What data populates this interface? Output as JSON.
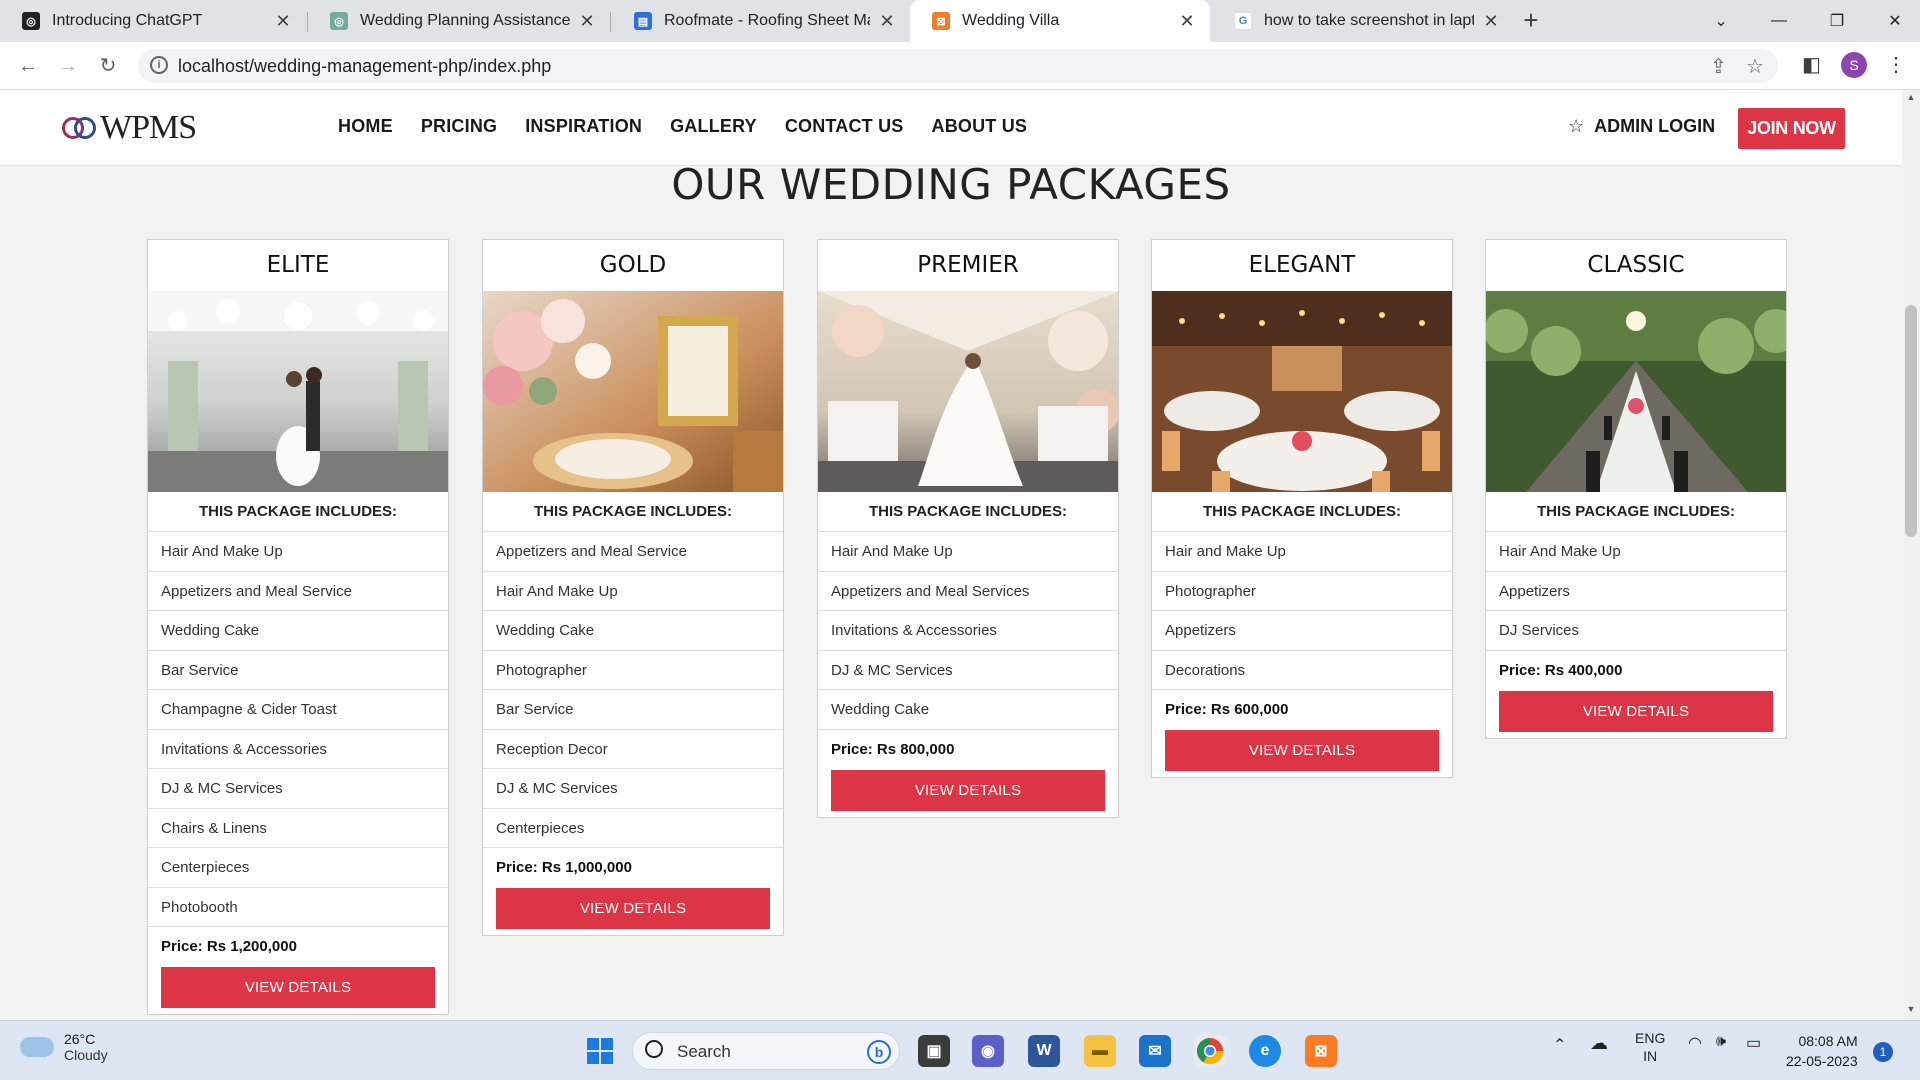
{
  "browser": {
    "tabs": [
      {
        "title": "Introducing ChatGPT",
        "icon": "chatgpt-icon"
      },
      {
        "title": "Wedding Planning Assistance",
        "icon": "chatgpt-icon"
      },
      {
        "title": "Roofmate - Roofing Sheet Manuf",
        "icon": "docs-icon"
      },
      {
        "title": "Wedding Villa",
        "icon": "xampp-icon"
      },
      {
        "title": "how to take screenshot in laptop",
        "icon": "google-icon"
      }
    ],
    "active_tab_index": 3,
    "url": "localhost/wedding-management-php/index.php",
    "profile_initial": "S"
  },
  "site": {
    "logo_text": "WPMS",
    "nav": [
      "HOME",
      "PRICING",
      "INSPIRATION",
      "GALLERY",
      "CONTACT US",
      "ABOUT US"
    ],
    "admin_login": "ADMIN LOGIN",
    "join_now": "JOIN NOW",
    "page_title": "OUR WEDDING PACKAGES",
    "includes_label": "THIS PACKAGE INCLUDES:",
    "view_details_label": "VIEW DETAILS",
    "accent_color": "#dc3545",
    "packages": [
      {
        "name": "ELITE",
        "image": "couple-dancing-chandelier-hall",
        "items": [
          "Hair And Make Up",
          "Appetizers and Meal Service",
          "Wedding Cake",
          "Bar Service",
          "Champagne & Cider Toast",
          "Invitations & Accessories",
          "DJ & MC Services",
          "Chairs & Linens",
          "Centerpieces",
          "Photobooth"
        ],
        "price": "Price: Rs 1,200,000"
      },
      {
        "name": "GOLD",
        "image": "table-setting-flowers-gold-frame",
        "items": [
          "Appetizers and Meal Service",
          "Hair And Make Up",
          "Wedding Cake",
          "Photographer",
          "Bar Service",
          "Reception Decor",
          "DJ & MC Services",
          "Centerpieces"
        ],
        "price": "Price: Rs 1,000,000"
      },
      {
        "name": "PREMIER",
        "image": "bride-in-floral-tent",
        "items": [
          "Hair And Make Up",
          "Appetizers and Meal Services",
          "Invitations & Accessories",
          "DJ & MC Services",
          "Wedding Cake"
        ],
        "price": "Price: Rs 800,000"
      },
      {
        "name": "ELEGANT",
        "image": "banquet-hall-round-tables",
        "items": [
          "Hair and Make Up",
          "Photographer",
          "Appetizers",
          "Decorations"
        ],
        "price": "Price: Rs 600,000"
      },
      {
        "name": "CLASSIC",
        "image": "greenhouse-long-table",
        "items": [
          "Hair And Make Up",
          "Appetizers",
          "DJ Services"
        ],
        "price": "Price: Rs 400,000"
      }
    ]
  },
  "taskbar": {
    "weather_temp": "26°C",
    "weather_desc": "Cloudy",
    "search_label": "Search",
    "lang_top": "ENG",
    "lang_bottom": "IN",
    "time": "08:08 AM",
    "date": "22-05-2023",
    "notification_count": "1"
  }
}
